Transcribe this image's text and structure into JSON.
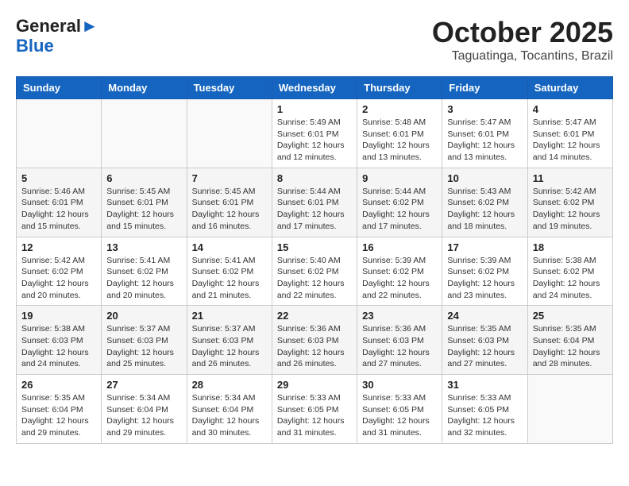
{
  "header": {
    "logo_general": "General",
    "logo_blue": "Blue",
    "title": "October 2025",
    "subtitle": "Taguatinga, Tocantins, Brazil"
  },
  "weekdays": [
    "Sunday",
    "Monday",
    "Tuesday",
    "Wednesday",
    "Thursday",
    "Friday",
    "Saturday"
  ],
  "weeks": [
    [
      {
        "day": "",
        "info": ""
      },
      {
        "day": "",
        "info": ""
      },
      {
        "day": "",
        "info": ""
      },
      {
        "day": "1",
        "info": "Sunrise: 5:49 AM\nSunset: 6:01 PM\nDaylight: 12 hours\nand 12 minutes."
      },
      {
        "day": "2",
        "info": "Sunrise: 5:48 AM\nSunset: 6:01 PM\nDaylight: 12 hours\nand 13 minutes."
      },
      {
        "day": "3",
        "info": "Sunrise: 5:47 AM\nSunset: 6:01 PM\nDaylight: 12 hours\nand 13 minutes."
      },
      {
        "day": "4",
        "info": "Sunrise: 5:47 AM\nSunset: 6:01 PM\nDaylight: 12 hours\nand 14 minutes."
      }
    ],
    [
      {
        "day": "5",
        "info": "Sunrise: 5:46 AM\nSunset: 6:01 PM\nDaylight: 12 hours\nand 15 minutes."
      },
      {
        "day": "6",
        "info": "Sunrise: 5:45 AM\nSunset: 6:01 PM\nDaylight: 12 hours\nand 15 minutes."
      },
      {
        "day": "7",
        "info": "Sunrise: 5:45 AM\nSunset: 6:01 PM\nDaylight: 12 hours\nand 16 minutes."
      },
      {
        "day": "8",
        "info": "Sunrise: 5:44 AM\nSunset: 6:01 PM\nDaylight: 12 hours\nand 17 minutes."
      },
      {
        "day": "9",
        "info": "Sunrise: 5:44 AM\nSunset: 6:02 PM\nDaylight: 12 hours\nand 17 minutes."
      },
      {
        "day": "10",
        "info": "Sunrise: 5:43 AM\nSunset: 6:02 PM\nDaylight: 12 hours\nand 18 minutes."
      },
      {
        "day": "11",
        "info": "Sunrise: 5:42 AM\nSunset: 6:02 PM\nDaylight: 12 hours\nand 19 minutes."
      }
    ],
    [
      {
        "day": "12",
        "info": "Sunrise: 5:42 AM\nSunset: 6:02 PM\nDaylight: 12 hours\nand 20 minutes."
      },
      {
        "day": "13",
        "info": "Sunrise: 5:41 AM\nSunset: 6:02 PM\nDaylight: 12 hours\nand 20 minutes."
      },
      {
        "day": "14",
        "info": "Sunrise: 5:41 AM\nSunset: 6:02 PM\nDaylight: 12 hours\nand 21 minutes."
      },
      {
        "day": "15",
        "info": "Sunrise: 5:40 AM\nSunset: 6:02 PM\nDaylight: 12 hours\nand 22 minutes."
      },
      {
        "day": "16",
        "info": "Sunrise: 5:39 AM\nSunset: 6:02 PM\nDaylight: 12 hours\nand 22 minutes."
      },
      {
        "day": "17",
        "info": "Sunrise: 5:39 AM\nSunset: 6:02 PM\nDaylight: 12 hours\nand 23 minutes."
      },
      {
        "day": "18",
        "info": "Sunrise: 5:38 AM\nSunset: 6:02 PM\nDaylight: 12 hours\nand 24 minutes."
      }
    ],
    [
      {
        "day": "19",
        "info": "Sunrise: 5:38 AM\nSunset: 6:03 PM\nDaylight: 12 hours\nand 24 minutes."
      },
      {
        "day": "20",
        "info": "Sunrise: 5:37 AM\nSunset: 6:03 PM\nDaylight: 12 hours\nand 25 minutes."
      },
      {
        "day": "21",
        "info": "Sunrise: 5:37 AM\nSunset: 6:03 PM\nDaylight: 12 hours\nand 26 minutes."
      },
      {
        "day": "22",
        "info": "Sunrise: 5:36 AM\nSunset: 6:03 PM\nDaylight: 12 hours\nand 26 minutes."
      },
      {
        "day": "23",
        "info": "Sunrise: 5:36 AM\nSunset: 6:03 PM\nDaylight: 12 hours\nand 27 minutes."
      },
      {
        "day": "24",
        "info": "Sunrise: 5:35 AM\nSunset: 6:03 PM\nDaylight: 12 hours\nand 27 minutes."
      },
      {
        "day": "25",
        "info": "Sunrise: 5:35 AM\nSunset: 6:04 PM\nDaylight: 12 hours\nand 28 minutes."
      }
    ],
    [
      {
        "day": "26",
        "info": "Sunrise: 5:35 AM\nSunset: 6:04 PM\nDaylight: 12 hours\nand 29 minutes."
      },
      {
        "day": "27",
        "info": "Sunrise: 5:34 AM\nSunset: 6:04 PM\nDaylight: 12 hours\nand 29 minutes."
      },
      {
        "day": "28",
        "info": "Sunrise: 5:34 AM\nSunset: 6:04 PM\nDaylight: 12 hours\nand 30 minutes."
      },
      {
        "day": "29",
        "info": "Sunrise: 5:33 AM\nSunset: 6:05 PM\nDaylight: 12 hours\nand 31 minutes."
      },
      {
        "day": "30",
        "info": "Sunrise: 5:33 AM\nSunset: 6:05 PM\nDaylight: 12 hours\nand 31 minutes."
      },
      {
        "day": "31",
        "info": "Sunrise: 5:33 AM\nSunset: 6:05 PM\nDaylight: 12 hours\nand 32 minutes."
      },
      {
        "day": "",
        "info": ""
      }
    ]
  ]
}
